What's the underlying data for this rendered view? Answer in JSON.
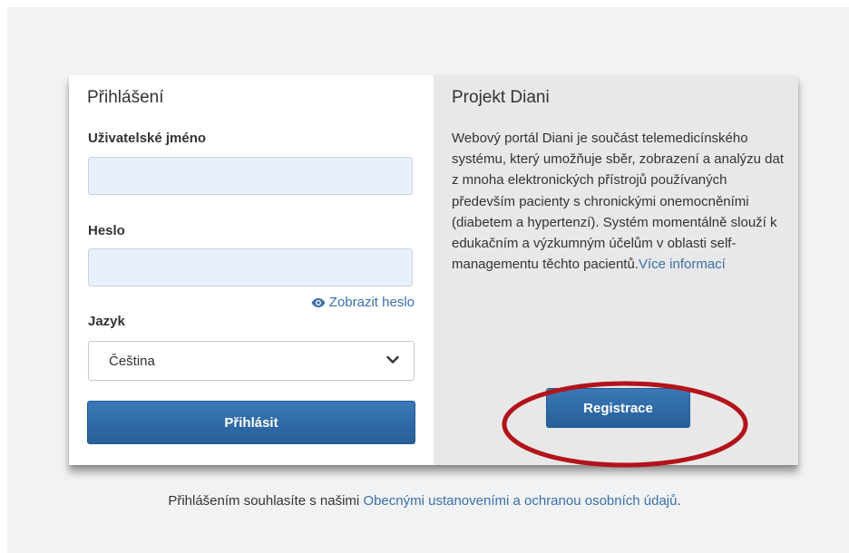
{
  "login": {
    "title": "Přihlášení",
    "username_label": "Uživatelské jméno",
    "username_value": "",
    "password_label": "Heslo",
    "password_value": "",
    "show_password": "Zobrazit heslo",
    "language_label": "Jazyk",
    "language_selected": "Čeština",
    "submit_label": "Přihlásit"
  },
  "project": {
    "title": "Projekt Diani",
    "description": "Webový portál Diani je součást telemedicínského systému, který umožňuje sběr, zobrazení a analýzu dat z mnoha elektronických přístrojů používaných především pacienty s chronickými onemocněními (diabetem a hypertenzí). Systém momentálně slouží k edukačním a výzkumným účelům v oblasti self-managementu těchto pacientů.",
    "more_link": "Více informací",
    "register_label": "Registrace"
  },
  "footer": {
    "prefix": "Přihlášením souhlasíte s našimi ",
    "link": "Obecnými ustanoveními a ochranou osobních údajů",
    "suffix": "."
  },
  "colors": {
    "accent": "#2d6aa6",
    "link": "#3b6fa8",
    "highlight": "#b3131b",
    "input_fill": "#e8f0fe"
  },
  "icons": {
    "show_password": "eye-icon",
    "select": "chevron-down-icon"
  }
}
